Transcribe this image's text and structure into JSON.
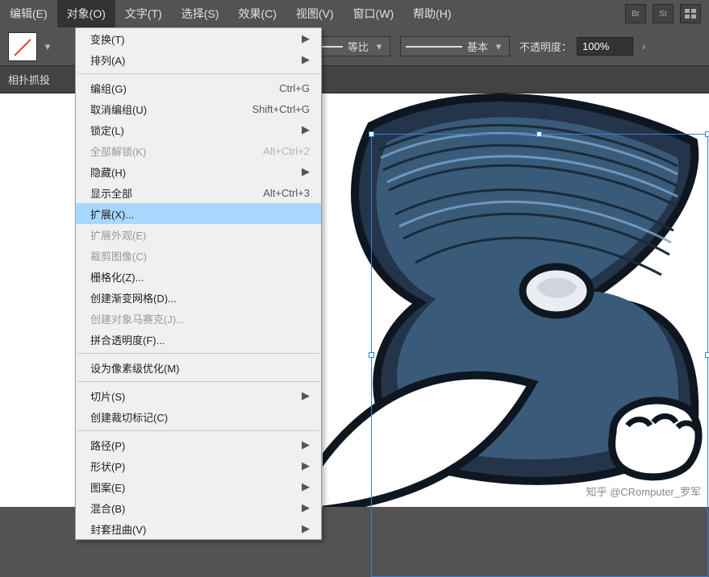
{
  "menubar": {
    "items": [
      "编辑(E)",
      "对象(O)",
      "文字(T)",
      "选择(S)",
      "效果(C)",
      "视图(V)",
      "窗口(W)",
      "帮助(H)"
    ],
    "icons": [
      "Br",
      "St"
    ]
  },
  "optionsbar": {
    "ratio_label": "等比",
    "stroke_label": "基本",
    "opacity_label": "不透明度：",
    "opacity_value": "100%"
  },
  "tabstrip": {
    "title": "相扑抓投"
  },
  "dropdown": [
    {
      "type": "item",
      "label": "变换(T)",
      "submenu": true
    },
    {
      "type": "item",
      "label": "排列(A)",
      "submenu": true
    },
    {
      "type": "sep"
    },
    {
      "type": "item",
      "label": "编组(G)",
      "shortcut": "Ctrl+G"
    },
    {
      "type": "item",
      "label": "取消编组(U)",
      "shortcut": "Shift+Ctrl+G"
    },
    {
      "type": "item",
      "label": "锁定(L)",
      "submenu": true
    },
    {
      "type": "item",
      "label": "全部解锁(K)",
      "shortcut": "Alt+Ctrl+2",
      "disabled": true
    },
    {
      "type": "item",
      "label": "隐藏(H)",
      "submenu": true
    },
    {
      "type": "item",
      "label": "显示全部",
      "shortcut": "Alt+Ctrl+3"
    },
    {
      "type": "item",
      "label": "扩展(X)...",
      "highlight": true
    },
    {
      "type": "item",
      "label": "扩展外观(E)",
      "disabled": true
    },
    {
      "type": "item",
      "label": "裁剪图像(C)",
      "disabled": true
    },
    {
      "type": "item",
      "label": "栅格化(Z)..."
    },
    {
      "type": "item",
      "label": "创建渐变网格(D)..."
    },
    {
      "type": "item",
      "label": "创建对象马赛克(J)...",
      "disabled": true
    },
    {
      "type": "item",
      "label": "拼合透明度(F)..."
    },
    {
      "type": "sep"
    },
    {
      "type": "item",
      "label": "设为像素级优化(M)"
    },
    {
      "type": "sep"
    },
    {
      "type": "item",
      "label": "切片(S)",
      "submenu": true
    },
    {
      "type": "item",
      "label": "创建裁切标记(C)"
    },
    {
      "type": "sep"
    },
    {
      "type": "item",
      "label": "路径(P)",
      "submenu": true
    },
    {
      "type": "item",
      "label": "形状(P)",
      "submenu": true
    },
    {
      "type": "item",
      "label": "图案(E)",
      "submenu": true
    },
    {
      "type": "item",
      "label": "混合(B)",
      "submenu": true
    },
    {
      "type": "item",
      "label": "封套扭曲(V)",
      "submenu": true
    }
  ],
  "watermark": "知乎 @CRomputer_罗军"
}
